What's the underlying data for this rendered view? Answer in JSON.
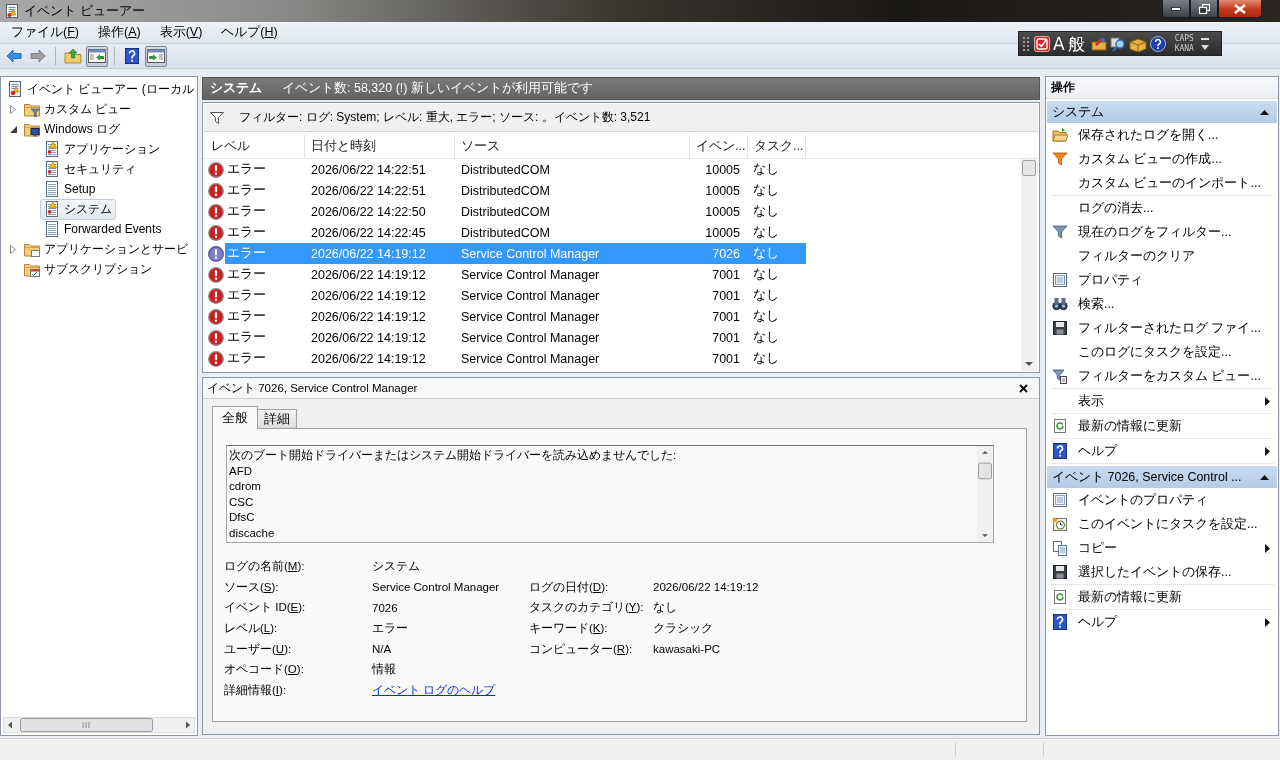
{
  "window": {
    "title": "イベント ビューアー"
  },
  "menu_bar": [
    {
      "label": [
        "ファイル(",
        "F",
        ")"
      ]
    },
    {
      "label": [
        "操作(",
        "A",
        ")"
      ]
    },
    {
      "label": [
        "表示(",
        "V",
        ")"
      ]
    },
    {
      "label": [
        "ヘルプ(",
        "H",
        ")"
      ]
    }
  ],
  "toolbar": [
    [
      {
        "kind": "back",
        "disabled": false,
        "pressed": false
      },
      {
        "kind": "forward",
        "disabled": true,
        "pressed": false
      }
    ],
    [
      {
        "kind": "up",
        "disabled": false,
        "pressed": false
      },
      {
        "kind": "treepane",
        "disabled": false,
        "pressed": true
      }
    ],
    [
      {
        "kind": "help",
        "disabled": false,
        "pressed": false
      },
      {
        "kind": "actionpane",
        "disabled": false,
        "pressed": true
      }
    ]
  ],
  "language_bar": {
    "input_mode": "A",
    "conversion_mode": "般",
    "caps": "CAPS",
    "kana": "KANA"
  },
  "tree": [
    {
      "label": "イベント ビューアー (ローカル",
      "kind": "root",
      "selected": false,
      "children": [
        {
          "label": "カスタム ビュー",
          "kind": "customviews",
          "expanded": false,
          "selected": false
        },
        {
          "label": "Windows ログ",
          "kind": "windowslogs",
          "expanded": true,
          "selected": false,
          "children": [
            {
              "label": "アプリケーション",
              "kind": "log",
              "selected": false
            },
            {
              "label": "セキュリティ",
              "kind": "log",
              "selected": false
            },
            {
              "label": "Setup",
              "kind": "plainlog",
              "selected": false
            },
            {
              "label": "システム",
              "kind": "log",
              "selected": true
            },
            {
              "label": "Forwarded Events",
              "kind": "plainlog",
              "selected": false
            }
          ]
        },
        {
          "label": "アプリケーションとサービ",
          "kind": "services",
          "expanded": false,
          "selected": false
        },
        {
          "label": "サブスクリプション",
          "kind": "subscriptions",
          "selected": false
        }
      ]
    }
  ],
  "event_list": {
    "title": "システム",
    "summary": "イベント数: 58,320 (!) 新しいイベントが利用可能です",
    "filter": "フィルター: ログ: System; レベル: 重大, エラー; ソース: 。イベント数: 3,521",
    "columns": [
      "レベル",
      "日付と時刻",
      "ソース",
      "イベン...",
      "タスク..."
    ],
    "rows": [
      {
        "kind": "error",
        "level": "エラー",
        "date": "2026/06/22 14:22:51",
        "source": "DistributedCOM",
        "event_id": "10005",
        "task": "なし",
        "selected": false
      },
      {
        "kind": "error",
        "level": "エラー",
        "date": "2026/06/22 14:22:51",
        "source": "DistributedCOM",
        "event_id": "10005",
        "task": "なし",
        "selected": false
      },
      {
        "kind": "error",
        "level": "エラー",
        "date": "2026/06/22 14:22:50",
        "source": "DistributedCOM",
        "event_id": "10005",
        "task": "なし",
        "selected": false
      },
      {
        "kind": "error",
        "level": "エラー",
        "date": "2026/06/22 14:22:45",
        "source": "DistributedCOM",
        "event_id": "10005",
        "task": "なし",
        "selected": false
      },
      {
        "kind": "error",
        "level": "エラー",
        "date": "2026/06/22 14:19:12",
        "source": "Service Control Manager",
        "event_id": "7026",
        "task": "なし",
        "selected": true
      },
      {
        "kind": "error",
        "level": "エラー",
        "date": "2026/06/22 14:19:12",
        "source": "Service Control Manager",
        "event_id": "7001",
        "task": "なし",
        "selected": false
      },
      {
        "kind": "error",
        "level": "エラー",
        "date": "2026/06/22 14:19:12",
        "source": "Service Control Manager",
        "event_id": "7001",
        "task": "なし",
        "selected": false
      },
      {
        "kind": "error",
        "level": "エラー",
        "date": "2026/06/22 14:19:12",
        "source": "Service Control Manager",
        "event_id": "7001",
        "task": "なし",
        "selected": false
      },
      {
        "kind": "error",
        "level": "エラー",
        "date": "2026/06/22 14:19:12",
        "source": "Service Control Manager",
        "event_id": "7001",
        "task": "なし",
        "selected": false
      },
      {
        "kind": "error",
        "level": "エラー",
        "date": "2026/06/22 14:19:12",
        "source": "Service Control Manager",
        "event_id": "7001",
        "task": "なし",
        "selected": false
      }
    ]
  },
  "event_detail": {
    "title": "イベント 7026, Service Control Manager",
    "tabs": [
      {
        "label": "全般",
        "selected": true
      },
      {
        "label": "詳細",
        "selected": false
      }
    ],
    "message_lines": [
      "次のブート開始ドライバーまたはシステム開始ドライバーを読み込めませんでした:",
      "AFD",
      "cdrom",
      "CSC",
      "DfsC",
      "discache"
    ],
    "fields": [
      {
        "left": {
          "label": [
            "ログの名前(",
            "M",
            "):"
          ],
          "value": "システム",
          "kind": "text"
        }
      },
      {
        "left": {
          "label": [
            "ソース(",
            "S",
            "):"
          ],
          "value": "Service Control Manager",
          "kind": "text"
        },
        "right": {
          "label": [
            "ログの日付(",
            "D",
            "):"
          ],
          "value": "2026/06/22 14:19:12",
          "kind": "text"
        }
      },
      {
        "left": {
          "label": [
            "イベント ID(",
            "E",
            "):"
          ],
          "value": "7026",
          "kind": "text"
        },
        "right": {
          "label": [
            "タスクのカテゴリ(",
            "Y",
            "):"
          ],
          "value": "なし",
          "kind": "text"
        }
      },
      {
        "left": {
          "label": [
            "レベル(",
            "L",
            "):"
          ],
          "value": "エラー",
          "kind": "text"
        },
        "right": {
          "label": [
            "キーワード(",
            "K",
            "):"
          ],
          "value": "クラシック",
          "kind": "text"
        }
      },
      {
        "left": {
          "label": [
            "ユーザー(",
            "U",
            "):"
          ],
          "value": "N/A",
          "kind": "text"
        },
        "right": {
          "label": [
            "コンピューター(",
            "R",
            "):"
          ],
          "value": "kawasaki-PC",
          "kind": "text"
        }
      },
      {
        "left": {
          "label": [
            "オペコード(",
            "O",
            "):"
          ],
          "value": "情報",
          "kind": "text"
        }
      },
      {
        "left": {
          "label": [
            "詳細情報(",
            "I",
            "):"
          ],
          "value": "イベント ログのヘルプ",
          "kind": "link"
        }
      }
    ]
  },
  "actions": {
    "title": "操作",
    "sections": [
      {
        "title": "システム",
        "expanded": true,
        "groups": [
          [
            {
              "label": "保存されたログを開く...",
              "kind": "open",
              "submenu": false
            },
            {
              "label": "カスタム ビューの作成...",
              "kind": "funnel",
              "submenu": false
            },
            {
              "label": "カスタム ビューのインポート...",
              "kind": "plain",
              "submenu": false
            }
          ],
          [
            {
              "label": "ログの消去...",
              "kind": "plain",
              "submenu": false
            },
            {
              "label": "現在のログをフィルター...",
              "kind": "filter",
              "submenu": false
            },
            {
              "label": "フィルターのクリア",
              "kind": "plain",
              "submenu": false
            },
            {
              "label": "プロパティ",
              "kind": "properties",
              "submenu": false
            },
            {
              "label": "検索...",
              "kind": "find",
              "submenu": false
            },
            {
              "label": "フィルターされたログ ファイ...",
              "kind": "save",
              "submenu": false
            },
            {
              "label": "このログにタスクを設定...",
              "kind": "plain",
              "submenu": false
            },
            {
              "label": "フィルターをカスタム ビュー...",
              "kind": "saveview",
              "submenu": false
            }
          ],
          [
            {
              "label": "表示",
              "kind": "plain",
              "submenu": true
            }
          ],
          [
            {
              "label": "最新の情報に更新",
              "kind": "refresh",
              "submenu": false
            }
          ],
          [
            {
              "label": "ヘルプ",
              "kind": "help",
              "submenu": true
            }
          ]
        ]
      },
      {
        "title": "イベント 7026, Service Control ...",
        "expanded": true,
        "groups": [
          [
            {
              "label": "イベントのプロパティ",
              "kind": "properties",
              "submenu": false
            },
            {
              "label": "このイベントにタスクを設定...",
              "kind": "task",
              "submenu": false
            },
            {
              "label": "コピー",
              "kind": "copy",
              "submenu": true
            },
            {
              "label": "選択したイベントの保存...",
              "kind": "save",
              "submenu": false
            }
          ],
          [
            {
              "label": "最新の情報に更新",
              "kind": "refresh",
              "submenu": false
            }
          ],
          [
            {
              "label": "ヘルプ",
              "kind": "help",
              "submenu": true
            }
          ]
        ]
      }
    ]
  }
}
